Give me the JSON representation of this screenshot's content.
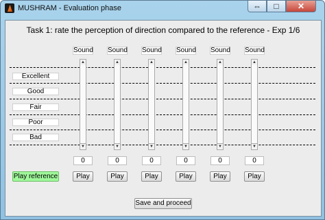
{
  "window": {
    "title": "MUSHRAM - Evaluation phase",
    "icon": "matlab-icon"
  },
  "title_controls": {
    "restore": "⇔",
    "maximize": "□",
    "close": "✕"
  },
  "task": {
    "title": "Task 1: rate the perception of direction compared to the reference - Exp 1/6"
  },
  "scale": [
    "Excellent",
    "Good",
    "Fair",
    "Poor",
    "Bad"
  ],
  "sounds": [
    {
      "label": "Sound",
      "rating": "0",
      "play": "Play"
    },
    {
      "label": "Sound",
      "rating": "0",
      "play": "Play"
    },
    {
      "label": "Sound",
      "rating": "0",
      "play": "Play"
    },
    {
      "label": "Sound",
      "rating": "0",
      "play": "Play"
    },
    {
      "label": "Sound",
      "rating": "0",
      "play": "Play"
    },
    {
      "label": "Sound",
      "rating": "0",
      "play": "Play"
    }
  ],
  "buttons": {
    "play_reference": "Play reference",
    "save": "Save and proceed"
  },
  "colors": {
    "reference_button": "#9ff89a",
    "panel": "#ececec",
    "titlebar": "#a9d3ec"
  }
}
